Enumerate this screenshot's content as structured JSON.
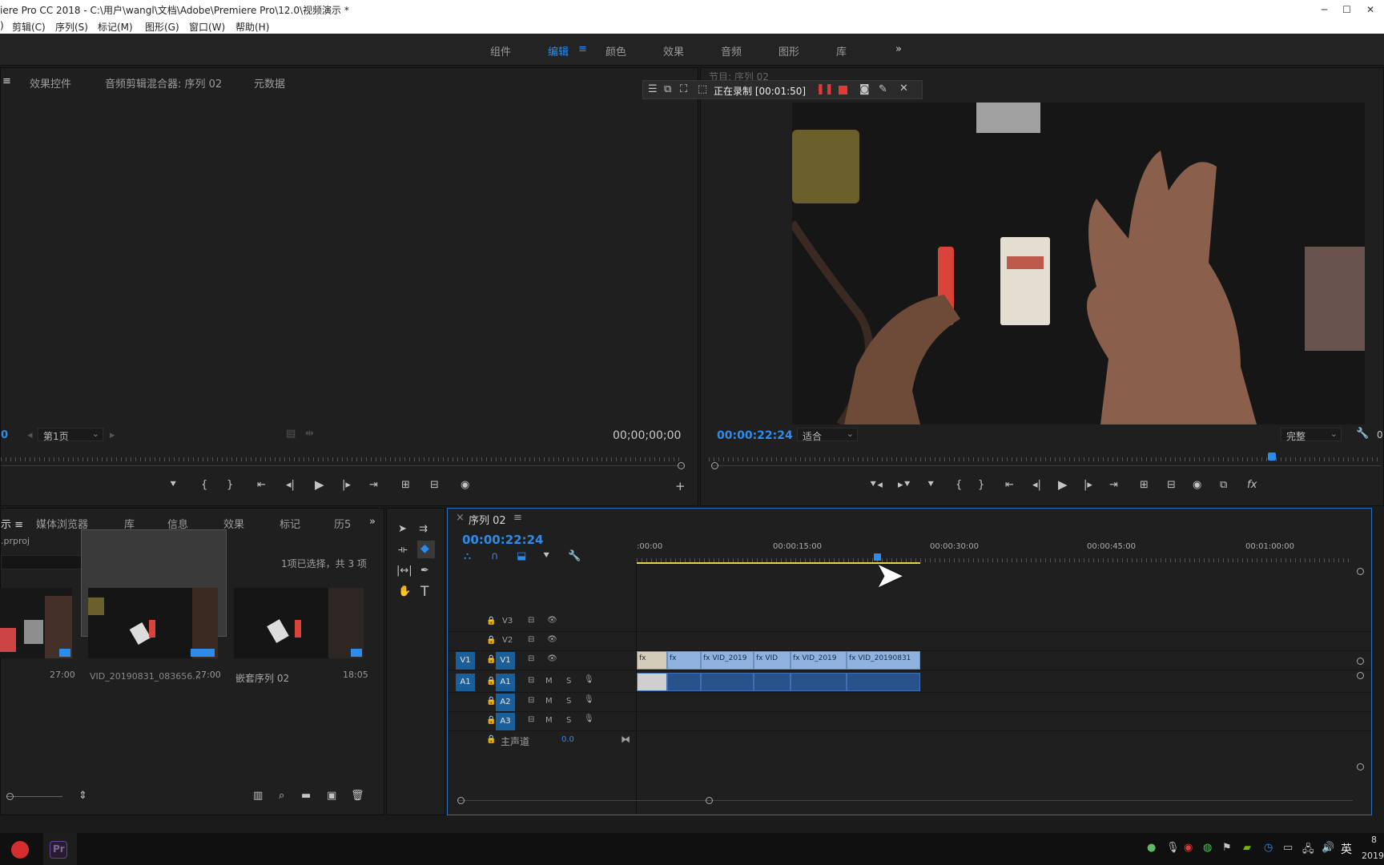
{
  "title_bar": {
    "title": "iere Pro CC 2018 - C:\\用户\\wangl\\文档\\Adobe\\Premiere Pro\\12.0\\视频演示 *"
  },
  "menu": [
    "剪辑(C)",
    "序列(S)",
    "标记(M)",
    "图形(G)",
    "窗口(W)",
    "帮助(H)"
  ],
  "workspaces": {
    "items": [
      "组件",
      "编辑",
      "颜色",
      "效果",
      "音频",
      "图形",
      "库"
    ],
    "active": "编辑",
    "more": "»"
  },
  "source_panel": {
    "tabs": [
      "效果控件",
      "音频剪辑混合器: 序列 02",
      "元数据"
    ],
    "page_label": "第1页",
    "timecode": "00;00;00;00",
    "left_value": "0"
  },
  "program_panel": {
    "tab_title": "节目: 序列 02",
    "recording_label": "正在录制 [00:01:50]",
    "timecode": "00:00:22:24",
    "fit_select": "适合",
    "quality_select": "完整",
    "right_value": "0"
  },
  "project_panel": {
    "tabs": [
      "媒体浏览器",
      "库",
      "信息",
      "效果",
      "标记",
      "历5"
    ],
    "file_name": ".prproj",
    "selection_status": "1项已选择，共 3 项",
    "items": [
      {
        "name": "",
        "duration": "27:00"
      },
      {
        "name": "VID_20190831_083656...",
        "duration": "27:00"
      },
      {
        "name": "嵌套序列 02",
        "duration": "18:05"
      }
    ]
  },
  "timeline": {
    "sequence_tab": "序列 02",
    "timecode": "00:00:22:24",
    "ruler_labels": [
      ":00:00",
      "00:00:15:00",
      "00:00:30:00",
      "00:00:45:00",
      "00:01:00:00"
    ],
    "video_tracks": [
      "V3",
      "V2",
      "V1"
    ],
    "audio_tracks": [
      "A1",
      "A2",
      "A3"
    ],
    "source_patch": {
      "video": "V1",
      "audio": "A1"
    },
    "master_label": "主声道",
    "master_value": "0.0",
    "track_buttons": {
      "mute": "M",
      "solo": "S"
    },
    "clips_v1": [
      "fx",
      "fx",
      "fx VID_2019",
      "fx VID",
      "fx VID_2019",
      "fx VID_20190831"
    ]
  },
  "taskbar": {
    "ime": "英",
    "clock_top": "8",
    "clock_bottom": "2019"
  }
}
